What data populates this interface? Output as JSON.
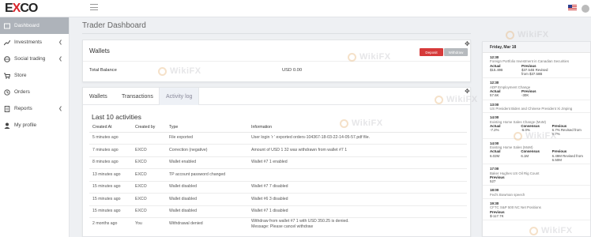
{
  "brand": {
    "logo_prefix": "E",
    "logo_x": "X",
    "logo_suffix": "CO"
  },
  "sidebar": {
    "items": [
      {
        "label": "Dashboard",
        "icon": "dashboard-icon",
        "has_chevron": false
      },
      {
        "label": "Investments",
        "icon": "chart-icon",
        "has_chevron": true
      },
      {
        "label": "Social trading",
        "icon": "globe-icon",
        "has_chevron": true
      },
      {
        "label": "Store",
        "icon": "cart-icon",
        "has_chevron": false
      },
      {
        "label": "Orders",
        "icon": "history-icon",
        "has_chevron": false
      },
      {
        "label": "Reports",
        "icon": "document-icon",
        "has_chevron": true
      },
      {
        "label": "My profile",
        "icon": "user-icon",
        "has_chevron": false
      }
    ]
  },
  "page": {
    "title": "Trader Dashboard"
  },
  "wallets": {
    "title": "Wallets",
    "deposit_label": "Deposit",
    "withdraw_label": "Withdraw",
    "balance_label": "Total Balance",
    "balance_value": "USD 0.00"
  },
  "tabs": [
    "Wallets",
    "Transactions",
    "Activity log"
  ],
  "activity": {
    "title": "Last 10 activities",
    "columns": [
      "Created At",
      "Created by",
      "Type",
      "Information"
    ],
    "rows": [
      [
        "5 minutes ago",
        "",
        "File exported",
        "User login ‘r   ’ exported orders-104367-18-03-22-14-05-57.pdf file."
      ],
      [
        "7 minutes ago",
        "EXCO",
        "Correction (negative)",
        "Amount of USD 1      32 was withdrawn from wallet #7       1"
      ],
      [
        "8 minutes ago",
        "EXCO",
        "Wallet enabled",
        "Wallet #7     1 enabled"
      ],
      [
        "13 minutes ago",
        "EXCO",
        "TP account password changed",
        ""
      ],
      [
        "15 minutes ago",
        "EXCO",
        "Wallet disabled",
        "Wallet #7     7 disabled"
      ],
      [
        "15 minutes ago",
        "EXCO",
        "Wallet disabled",
        "Wallet #6     3 disabled"
      ],
      [
        "15 minutes ago",
        "EXCO",
        "Wallet disabled",
        "Wallet #7     1 disabled"
      ],
      [
        "2 months ago",
        "You",
        "Withdrawal denied",
        "Withdraw from wallet #7       1 with USD 350.25 is denied.\nMessage: Please cancel withdraw"
      ]
    ]
  },
  "events": {
    "date": "Friday, Mar 18",
    "items": [
      {
        "time": "12:30",
        "name": "Foreign Portfolio Investment in Canadian Securities",
        "cols": [
          {
            "h": "Actual",
            "v": "$15.49B"
          },
          {
            "h": "Previous",
            "v": "$37.54B Revised from $37.58B"
          }
        ]
      },
      {
        "time": "12:30",
        "name": "ADP Employment Change",
        "cols": [
          {
            "h": "Actual",
            "v": "57.6K"
          },
          {
            "h": "Previous",
            "v": "-30K"
          }
        ]
      },
      {
        "time": "13:00",
        "name": "US President Biden and Chinese President Xi Jinping",
        "cols": []
      },
      {
        "time": "14:00",
        "name": "Existing Home Sales Change (MoM)",
        "cols": [
          {
            "h": "Actual",
            "v": "-7.2%"
          },
          {
            "h": "Consensus",
            "v": "-6.0%"
          },
          {
            "h": "Previous",
            "v": "6.7% Revised from 6.7%"
          }
        ]
      },
      {
        "time": "14:00",
        "name": "Existing Home Sales (MoM)",
        "cols": [
          {
            "h": "Actual",
            "v": "6.02M"
          },
          {
            "h": "Consensus",
            "v": "6.1M"
          },
          {
            "h": "Previous",
            "v": "6.49M Revised from 6.50M"
          }
        ]
      },
      {
        "time": "17:00",
        "name": "Baker Hughes US Oil Rig Count",
        "cols": [
          {
            "h": "Previous",
            "v": "527"
          }
        ]
      },
      {
        "time": "18:00",
        "name": "Fed's Bowman speech",
        "cols": []
      },
      {
        "time": "19:30",
        "name": "CFTC S&P 500 NC Net Positions",
        "cols": [
          {
            "h": "Previous",
            "v": "$-117.7K"
          }
        ]
      }
    ]
  },
  "watermark": "WikiFX",
  "colors": {
    "accent_red": "#d63a3a",
    "sidebar_active": "#aeb3ba",
    "brand_x": "#d9262c"
  }
}
